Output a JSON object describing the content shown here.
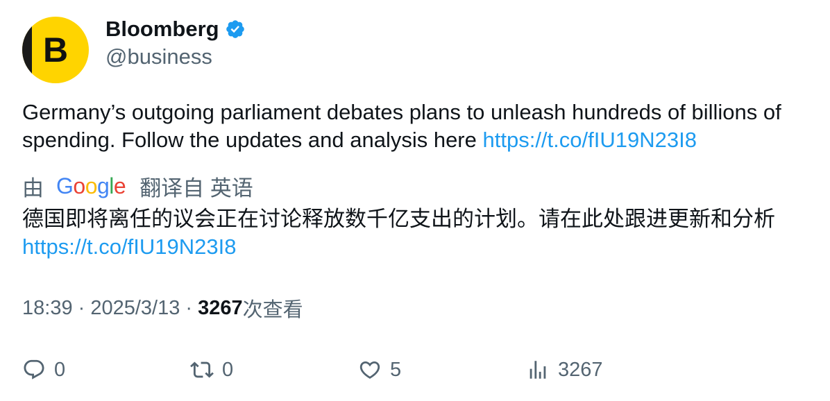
{
  "author": {
    "avatar_letter": "B",
    "display_name": "Bloomberg",
    "handle": "@business",
    "verified_icon": "verified-badge-icon",
    "verified_color": "#1d9bf0"
  },
  "tweet": {
    "text": "Germany’s outgoing parliament debates plans to unleash hundreds of billions of spending. Follow the updates and analysis here ",
    "link": "https://t.co/fIU19N23I8"
  },
  "translation": {
    "prefix": "由",
    "provider": "Google",
    "suffix": "翻译自 英语",
    "text": "德国即将离任的议会正在讨论释放数千亿支出的计划。请在此处跟进更新和分析",
    "link": "https://t.co/fIU19N23I8"
  },
  "meta": {
    "time": "18:39",
    "separator": " · ",
    "date": "2025/3/13",
    "views_count": "3267",
    "views_label": "次查看"
  },
  "actions": {
    "reply_count": "0",
    "retweet_count": "0",
    "like_count": "5",
    "views_count": "3267"
  },
  "colors": {
    "link": "#1d9bf0",
    "secondary_text": "#536471",
    "primary_text": "#0f1419",
    "avatar_bg": "#ffd400"
  }
}
